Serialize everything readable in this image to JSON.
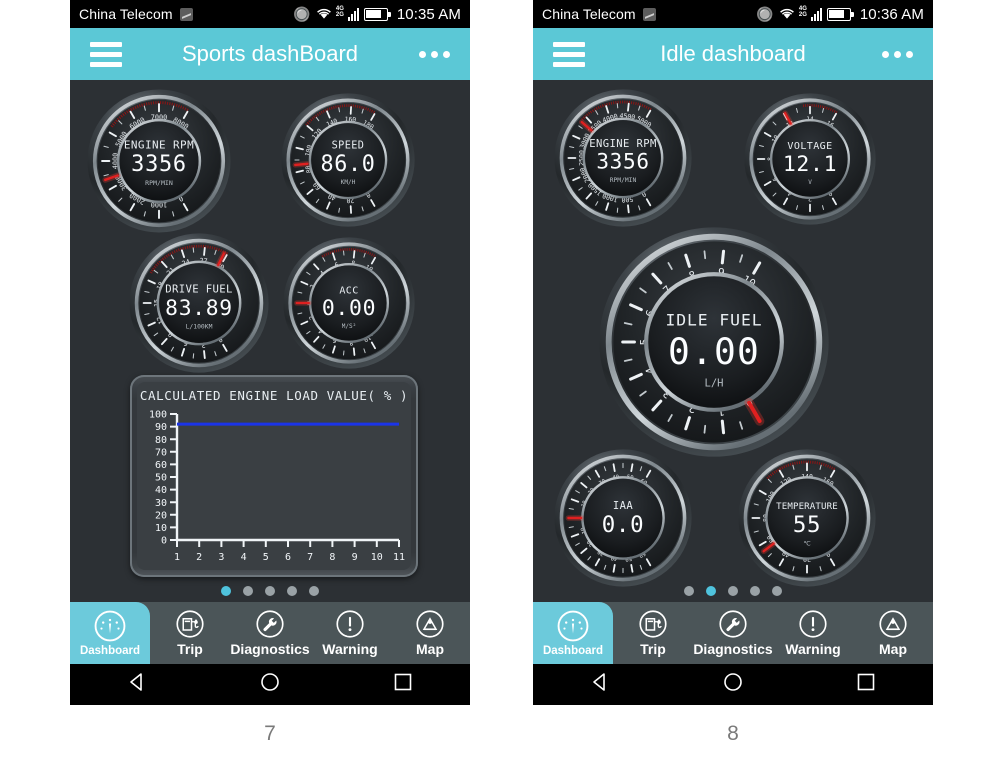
{
  "page": {
    "background": "#ffffff",
    "accent": "#5bc8d6",
    "screen_bg": "#2c3034",
    "nav_bg": "#4b5558",
    "needle_color": "#e02020",
    "chart_line_color": "#1b34e8"
  },
  "captions": {
    "left": "7",
    "right": "8"
  },
  "phones": [
    {
      "id": "sports-dashboard",
      "status_bar": {
        "carrier": "China Telecom",
        "time": "10:35 AM",
        "icons": [
          "sim-icon",
          "bluetooth-icon",
          "wifi-icon",
          "signal-4g-2g-icon",
          "battery-icon"
        ],
        "network_top": "4G",
        "network_bottom": "2G"
      },
      "app_bar": {
        "menu_icon": "hamburger-icon",
        "title": "Sports dashBoard",
        "overflow_icon": "more-options-icon"
      },
      "gauges": [
        {
          "name": "engine-rpm",
          "label": "ENGINE RPM",
          "value": "3356",
          "unit": "RPM/MIN",
          "min": 0,
          "max": 8000,
          "step": 1000,
          "ticks": [
            "0",
            "1000",
            "2000",
            "3000",
            "4000",
            "5000",
            "6000",
            "7000",
            "8000"
          ],
          "needle_value": 3356,
          "redline_start": 5200
        },
        {
          "name": "speed",
          "label": "SPEED",
          "value": "86.0",
          "unit": "KM/H",
          "min": 0,
          "max": 180,
          "step": 20,
          "ticks": [
            "0",
            "20",
            "40",
            "60",
            "80",
            "100",
            "120",
            "140",
            "160",
            "180"
          ],
          "needle_value": 86.0,
          "redline_start": 120
        },
        {
          "name": "drive-fuel",
          "label": "DRIVE FUEL",
          "value": "83.89",
          "unit": "L/100KM",
          "min": 0,
          "max": 30,
          "step": 3,
          "ticks": [
            "0",
            "3",
            "6",
            "9",
            "12",
            "15",
            "18",
            "21",
            "24",
            "27",
            "30"
          ],
          "needle_value": 29.6,
          "redline_start": 19
        },
        {
          "name": "acc",
          "label": "ACC",
          "value": "0.00",
          "unit": "M/S²",
          "min": -10,
          "max": 10,
          "step": 2,
          "ticks": [
            "-10",
            "-8",
            "-6",
            "-4",
            "-2",
            "0",
            "2",
            "4",
            "6",
            "8",
            "10"
          ],
          "needle_value": 0,
          "redline_start": 5
        }
      ],
      "chart_data": {
        "type": "line",
        "title": "CALCULATED ENGINE LOAD VALUE( % )",
        "xlabel": "",
        "ylabel": "",
        "x": [
          1,
          2,
          3,
          4,
          5,
          6,
          7,
          8,
          9,
          10,
          11
        ],
        "values": [
          92,
          92,
          92,
          92,
          92,
          92,
          92,
          92,
          92,
          92,
          92
        ],
        "series": [
          {
            "name": "Calculated engine load value",
            "values": [
              92,
              92,
              92,
              92,
              92,
              92,
              92,
              92,
              92,
              92,
              92
            ]
          }
        ],
        "categories": [
          "1",
          "2",
          "3",
          "4",
          "5",
          "6",
          "7",
          "8",
          "9",
          "10",
          "11"
        ],
        "yticks": [
          "0",
          "10",
          "20",
          "30",
          "40",
          "50",
          "60",
          "70",
          "80",
          "90",
          "100"
        ],
        "ylim": [
          0,
          100
        ],
        "xlim": [
          1,
          11
        ],
        "grid": false,
        "legend": "none",
        "line_color": "#1b34e8"
      },
      "page_dots": {
        "count": 5,
        "active": 0
      },
      "bottom_nav": {
        "items": [
          {
            "label": "Dashboard",
            "icon": "speedometer-icon",
            "active": true
          },
          {
            "label": "Trip",
            "icon": "fuel-pump-icon",
            "active": false
          },
          {
            "label": "Diagnostics",
            "icon": "wrench-icon",
            "active": false
          },
          {
            "label": "Warning",
            "icon": "exclamation-circle-icon",
            "active": false
          },
          {
            "label": "Map",
            "icon": "map-pin-icon",
            "active": false
          }
        ]
      },
      "android_nav": [
        "back-triangle-icon",
        "home-circle-icon",
        "recents-square-icon"
      ]
    },
    {
      "id": "idle-dashboard",
      "status_bar": {
        "carrier": "China Telecom",
        "time": "10:36 AM",
        "icons": [
          "sim-icon",
          "bluetooth-icon",
          "wifi-icon",
          "signal-4g-2g-icon",
          "battery-icon"
        ],
        "network_top": "4G",
        "network_bottom": "2G"
      },
      "app_bar": {
        "menu_icon": "hamburger-icon",
        "title": "Idle dashboard",
        "overflow_icon": "more-options-icon"
      },
      "gauges": [
        {
          "name": "engine-rpm",
          "label": "ENGINE RPM",
          "value": "3356",
          "unit": "RPM/MIN",
          "min": 0,
          "max": 5000,
          "step": 500,
          "ticks": [
            "0",
            "500",
            "1000",
            "1500",
            "2000",
            "2500",
            "3000",
            "3500",
            "4000",
            "4500",
            "5000"
          ],
          "needle_value": 3356,
          "redline_start": 3400
        },
        {
          "name": "voltage",
          "label": "VOLTAGE",
          "value": "12.1",
          "unit": "V",
          "min": 0,
          "max": 16,
          "step": 2,
          "ticks": [
            "0",
            "2",
            "4",
            "6",
            "8",
            "10",
            "12",
            "14",
            "16"
          ],
          "needle_value": 12.1,
          "redline_start": 13.5
        },
        {
          "name": "idle-fuel",
          "label": "IDLE FUEL",
          "value": "0.00",
          "unit": "L/H",
          "min": 0,
          "max": 10,
          "step": 1,
          "ticks": [
            "0",
            "1",
            "2",
            "3",
            "4",
            "5",
            "6",
            "7",
            "8",
            "9",
            "10"
          ],
          "needle_value": 0,
          "redline_start": 99
        },
        {
          "name": "iat",
          "label": "IAA",
          "value": "0.0",
          "unit": "",
          "min": -60,
          "max": 60,
          "step": 10,
          "ticks": [
            "-60",
            "-50",
            "-40",
            "-30",
            "-20",
            "-10",
            "0",
            "10",
            "20",
            "30",
            "40",
            "50",
            "60"
          ],
          "needle_value": 0,
          "redline_start": 99
        },
        {
          "name": "temperature",
          "label": "TEMPERATURE",
          "value": "55",
          "unit": "℃",
          "min": 0,
          "max": 160,
          "step": 20,
          "ticks": [
            "0",
            "20",
            "40",
            "60",
            "80",
            "100",
            "120",
            "140",
            "160"
          ],
          "needle_value": 55,
          "redline_start": 110
        }
      ],
      "page_dots": {
        "count": 5,
        "active": 1
      },
      "bottom_nav": {
        "items": [
          {
            "label": "Dashboard",
            "icon": "speedometer-icon",
            "active": true
          },
          {
            "label": "Trip",
            "icon": "fuel-pump-icon",
            "active": false
          },
          {
            "label": "Diagnostics",
            "icon": "wrench-icon",
            "active": false
          },
          {
            "label": "Warning",
            "icon": "exclamation-circle-icon",
            "active": false
          },
          {
            "label": "Map",
            "icon": "map-pin-icon",
            "active": false
          }
        ]
      },
      "android_nav": [
        "back-triangle-icon",
        "home-circle-icon",
        "recents-square-icon"
      ]
    }
  ]
}
